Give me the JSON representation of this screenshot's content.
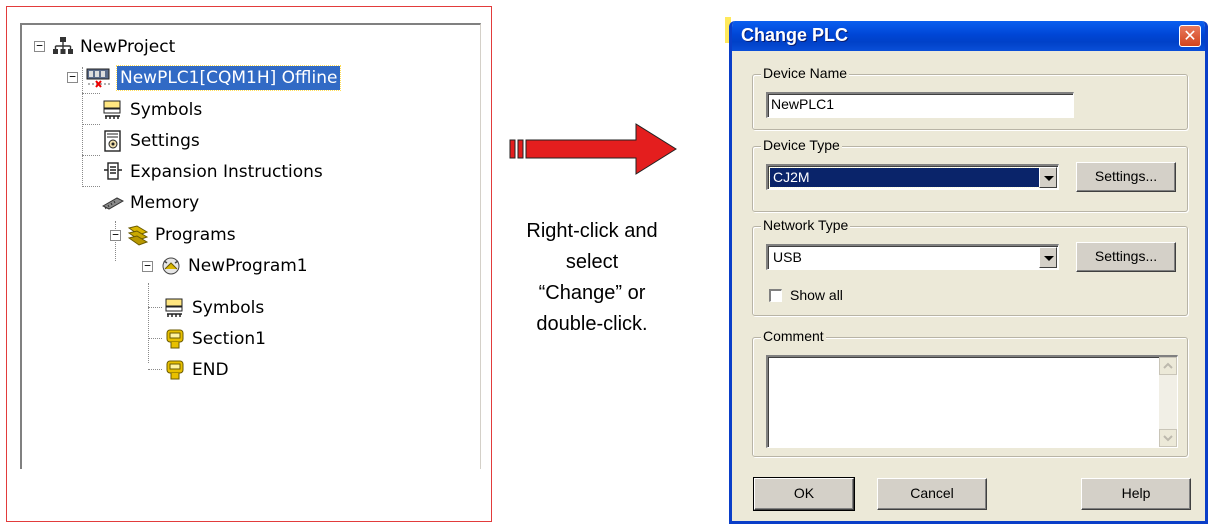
{
  "tree": {
    "items": [
      {
        "label": "NewProject",
        "icon": "network-icon"
      },
      {
        "label": "NewPLC1[CQM1H] Offline",
        "icon": "plc-offline-icon",
        "selected": true
      },
      {
        "label": "Symbols",
        "icon": "symbols-icon"
      },
      {
        "label": "Settings",
        "icon": "settings-icon"
      },
      {
        "label": "Expansion Instructions",
        "icon": "expansion-icon"
      },
      {
        "label": "Memory",
        "icon": "memory-icon"
      },
      {
        "label": "Programs",
        "icon": "programs-icon"
      },
      {
        "label": "NewProgram1",
        "icon": "program-icon"
      },
      {
        "label": "Symbols",
        "icon": "symbols-icon"
      },
      {
        "label": "Section1",
        "icon": "section-icon"
      },
      {
        "label": "END",
        "icon": "section-icon"
      }
    ]
  },
  "caption": {
    "line1": "Right-click and",
    "line2": "select",
    "line3": "“Change” or",
    "line4": "double-click."
  },
  "dialog": {
    "title": "Change PLC",
    "close_glyph": "✕",
    "device_name": {
      "label": "Device Name",
      "value": "NewPLC1"
    },
    "device_type": {
      "label": "Device Type",
      "value": "CJ2M",
      "settings_label": "Settings..."
    },
    "network_type": {
      "label": "Network Type",
      "value": "USB",
      "settings_label": "Settings...",
      "show_all_label": "Show all",
      "show_all_checked": false
    },
    "comment": {
      "label": "Comment",
      "value": ""
    },
    "ok_label": "OK",
    "cancel_label": "Cancel",
    "help_label": "Help"
  },
  "colors": {
    "frame_border": "#e23b3b",
    "arrow_fill": "#e41e1e",
    "selection": "#316ac5",
    "titlebar": "#0046d6"
  }
}
